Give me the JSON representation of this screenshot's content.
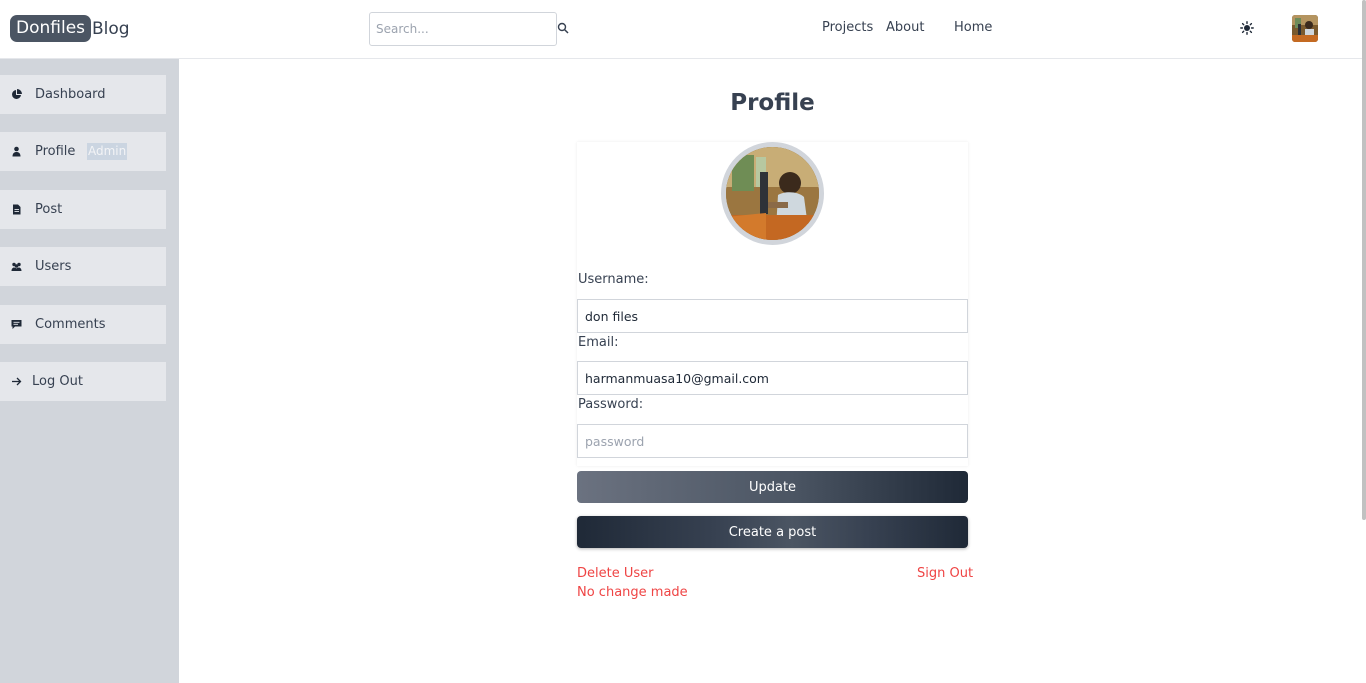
{
  "header": {
    "logo_badge": "Donfiles",
    "logo_rest": "Blog",
    "search_placeholder": "Search...",
    "nav": [
      "Projects",
      "About",
      "Home"
    ]
  },
  "sidebar": {
    "items": [
      {
        "label": "Dashboard",
        "icon": "pie-chart-icon"
      },
      {
        "label": "Profile",
        "icon": "user-icon",
        "badge": "Admin"
      },
      {
        "label": "Post",
        "icon": "document-icon"
      },
      {
        "label": "Users",
        "icon": "users-icon"
      },
      {
        "label": "Comments",
        "icon": "comment-icon"
      },
      {
        "label": "Log Out",
        "icon": "arrow-right-icon"
      }
    ]
  },
  "profile": {
    "title": "Profile",
    "username_label": "Username:",
    "username_value": "don files",
    "email_label": "Email:",
    "email_value": "harmanmuasa10@gmail.com",
    "password_label": "Password:",
    "password_placeholder": "password",
    "update_label": "Update",
    "create_post_label": "Create a post",
    "delete_user_label": "Delete User",
    "sign_out_label": "Sign Out",
    "status_message": "No change made"
  },
  "colors": {
    "sidebar_bg": "#d1d5db",
    "sidebar_item_bg": "#e5e7eb",
    "danger": "#ef4444",
    "dark": "#1f2937"
  }
}
